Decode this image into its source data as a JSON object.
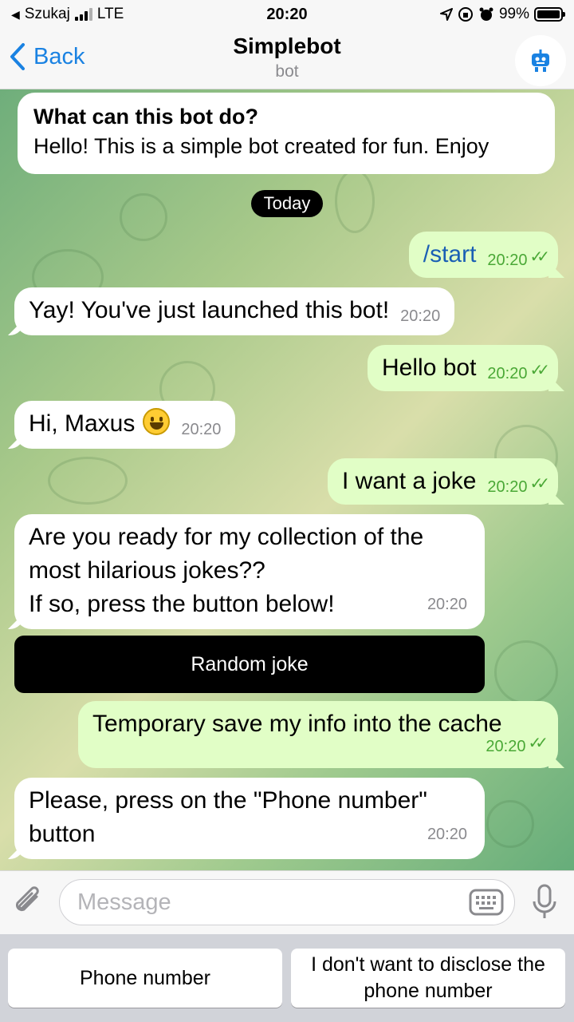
{
  "status_bar": {
    "carrier": "Szukaj",
    "network": "LTE",
    "time": "20:20",
    "battery": "99%",
    "battery_level": 0.99
  },
  "header": {
    "back_label": "Back",
    "title": "Simplebot",
    "subtitle": "bot",
    "avatar_icon": "robot-icon"
  },
  "intro": {
    "title": "What can this bot do?",
    "text": "Hello!  This is a simple bot created for fun. Enjoy"
  },
  "date_separator": "Today",
  "messages": [
    {
      "dir": "out",
      "text": "/start",
      "time": "20:20"
    },
    {
      "dir": "in",
      "text": "Yay! You've just launched this bot!",
      "time": "20:20"
    },
    {
      "dir": "out",
      "text": "Hello bot",
      "time": "20:20"
    },
    {
      "dir": "in",
      "text": "Hi, Maxus",
      "time": "20:20",
      "emoji": "smiling-face"
    },
    {
      "dir": "out",
      "text": "I want a joke",
      "time": "20:20"
    },
    {
      "dir": "in",
      "lines": [
        "Are you ready for my collection of the",
        "most hilarious jokes??",
        "If so, press the button below!"
      ],
      "time": "20:20"
    },
    {
      "dir": "out",
      "text": "Temporary save my info into the cache",
      "time": "20:20"
    },
    {
      "dir": "in",
      "lines": [
        "Please, press on the \"Phone number\"",
        "button"
      ],
      "time": "20:20"
    }
  ],
  "inline_button": "Random joke",
  "input": {
    "placeholder": "Message",
    "value": ""
  },
  "reply_keyboard": [
    {
      "label": "Phone number"
    },
    {
      "lines": [
        "I don't want to disclose the",
        "phone number"
      ]
    }
  ],
  "colors": {
    "accent": "#1a82e2",
    "outgoing_bubble": "#e1fec6",
    "incoming_bubble": "#ffffff",
    "read_check": "#4aa836"
  }
}
